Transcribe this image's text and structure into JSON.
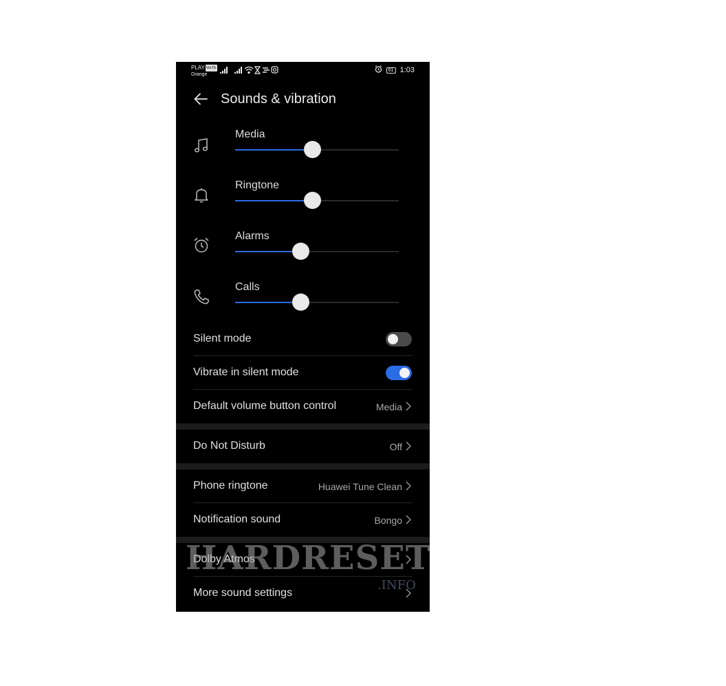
{
  "status_bar": {
    "carrier_line1": "PLAY",
    "carrier_badge": "VoLTE",
    "carrier_line2": "Orange",
    "battery": "61",
    "time": "1:03"
  },
  "header": {
    "title": "Sounds & vibration"
  },
  "volumes": [
    {
      "label": "Media",
      "icon": "music-note-icon",
      "level": 0.47
    },
    {
      "label": "Ringtone",
      "icon": "bell-icon",
      "level": 0.47
    },
    {
      "label": "Alarms",
      "icon": "alarm-clock-icon",
      "level": 0.4
    },
    {
      "label": "Calls",
      "icon": "phone-icon",
      "level": 0.4
    }
  ],
  "settings": {
    "silent_mode": {
      "label": "Silent mode",
      "enabled": false
    },
    "vibrate_silent": {
      "label": "Vibrate in silent mode",
      "enabled": true
    },
    "default_volume": {
      "label": "Default volume button control",
      "value": "Media"
    },
    "dnd": {
      "label": "Do Not Disturb",
      "value": "Off"
    },
    "phone_ringtone": {
      "label": "Phone ringtone",
      "value": "Huawei Tune Clean"
    },
    "notification_sound": {
      "label": "Notification sound",
      "value": "Bongo"
    },
    "dolby": {
      "label": "Dolby Atmos"
    },
    "more_sound": {
      "label": "More sound settings"
    }
  },
  "watermark": {
    "main": "HARDRESET",
    "sub": ".INFO"
  },
  "colors": {
    "accent": "#2a6be6",
    "background": "#000000",
    "text": "#e0e0e0",
    "secondary_text": "#a8a8a8"
  }
}
